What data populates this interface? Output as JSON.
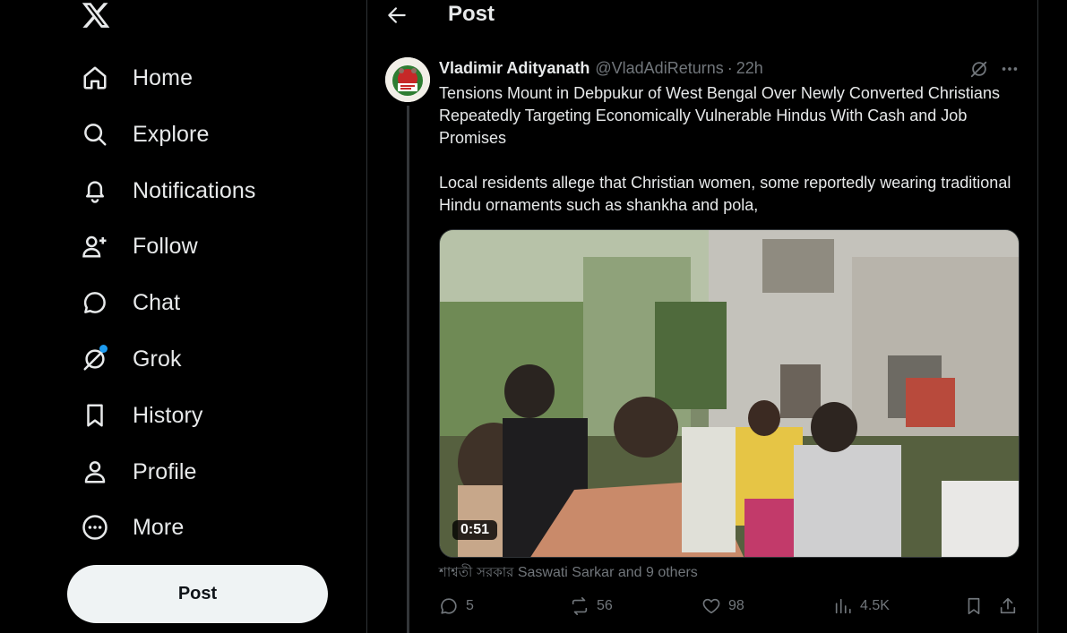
{
  "nav": {
    "logo": "x-logo",
    "items": [
      {
        "label": "Home",
        "icon": "home-icon"
      },
      {
        "label": "Explore",
        "icon": "search-icon"
      },
      {
        "label": "Notifications",
        "icon": "bell-icon"
      },
      {
        "label": "Follow",
        "icon": "add-person-icon"
      },
      {
        "label": "Chat",
        "icon": "chat-bubble-icon"
      },
      {
        "label": "Grok",
        "icon": "grok-icon"
      },
      {
        "label": "History",
        "icon": "bookmark-icon"
      },
      {
        "label": "Profile",
        "icon": "person-icon"
      },
      {
        "label": "More",
        "icon": "more-circle-icon"
      }
    ],
    "post_label": "Post"
  },
  "header": {
    "title": "Post"
  },
  "tweet": {
    "author_name": "Vladimir Adityanath",
    "handle": "@VladAdiReturns",
    "separator": "·",
    "time": "22h",
    "text_line1": "Tensions Mount in Debpukur of West Bengal Over Newly Converted Christians Repeatedly Targeting Economically Vulnerable Hindus With Cash and Job Promises",
    "text_line2": "Local residents allege that Christian women, some reportedly wearing traditional Hindu ornaments such as shankha and pola,",
    "video_duration": "0:51",
    "tagged_bn": "শাশ্বতী সরকার",
    "tagged_en": "Saswati Sarkar and 9 others",
    "replies": "5",
    "reposts": "56",
    "likes": "98",
    "views": "4.5K"
  },
  "colors": {
    "background": "#000000",
    "text": "#e7e9ea",
    "muted": "#71767b",
    "border": "#2f3336",
    "accent": "#1d9bf0"
  }
}
